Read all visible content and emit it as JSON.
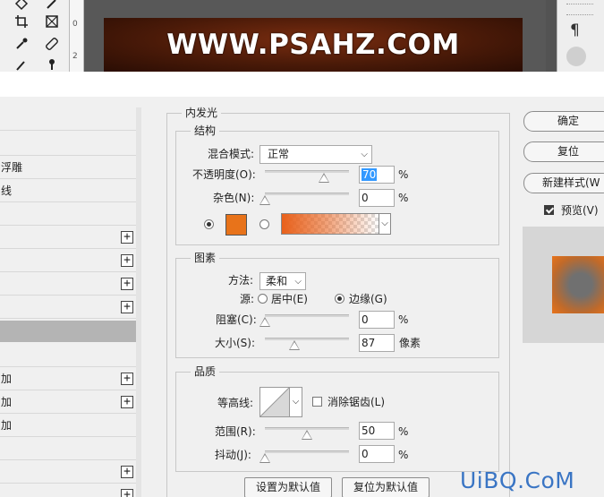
{
  "banner": {
    "text": "WWW.PSAHZ.COM"
  },
  "ruler": {
    "marks": [
      "0",
      "2"
    ]
  },
  "tools": [
    "move-icon",
    "crop-icon",
    "frame-icon",
    "eyedropper-icon",
    "healing-icon",
    "brush-icon",
    "stamp-icon"
  ],
  "styles_list": {
    "items": [
      {
        "label": "",
        "plus": false
      },
      {
        "label": "",
        "plus": false
      },
      {
        "label": "浮雕",
        "plus": false
      },
      {
        "label": "线",
        "plus": false
      },
      {
        "label": "",
        "plus": false
      },
      {
        "label": "",
        "plus": true
      },
      {
        "label": "",
        "plus": true
      },
      {
        "label": "",
        "plus": true
      },
      {
        "label": "",
        "plus": true
      },
      {
        "label": "",
        "plus": false,
        "selected": true
      },
      {
        "label": "",
        "plus": false
      },
      {
        "label": "加",
        "plus": true
      },
      {
        "label": "加",
        "plus": true
      },
      {
        "label": "加",
        "plus": false
      },
      {
        "label": "",
        "plus": false
      },
      {
        "label": "",
        "plus": true
      },
      {
        "label": "",
        "plus": true
      }
    ]
  },
  "dialog": {
    "section_title": "内发光",
    "structure": {
      "title": "结构",
      "blend_mode_label": "混合模式:",
      "blend_mode_value": "正常",
      "opacity_label": "不透明度(O):",
      "opacity_value": "70",
      "opacity_unit": "%",
      "opacity_fraction": 0.7,
      "noise_label": "杂色(N):",
      "noise_value": "0",
      "noise_unit": "%",
      "noise_fraction": 0,
      "glow_color": "#e8731a"
    },
    "elements": {
      "title": "图素",
      "technique_label": "方法:",
      "technique_value": "柔和",
      "source_label": "源:",
      "source_center": "居中(E)",
      "source_edge": "边缘(G)",
      "choke_label": "阻塞(C):",
      "choke_value": "0",
      "choke_unit": "%",
      "choke_fraction": 0,
      "size_label": "大小(S):",
      "size_value": "87",
      "size_unit": "像素",
      "size_fraction": 0.35
    },
    "quality": {
      "title": "品质",
      "contour_label": "等高线:",
      "anti_alias_label": "消除锯齿(L)",
      "range_label": "范围(R):",
      "range_value": "50",
      "range_unit": "%",
      "range_fraction": 0.5,
      "jitter_label": "抖动(J):",
      "jitter_value": "0",
      "jitter_unit": "%",
      "jitter_fraction": 0
    },
    "buttons": {
      "make_default": "设置为默认值",
      "reset_default": "复位为默认值"
    }
  },
  "side_buttons": {
    "ok": "确定",
    "reset": "复位",
    "new_style": "新建样式(W",
    "preview_label": "预览(V)"
  },
  "watermark": "UiBQ.CoM"
}
